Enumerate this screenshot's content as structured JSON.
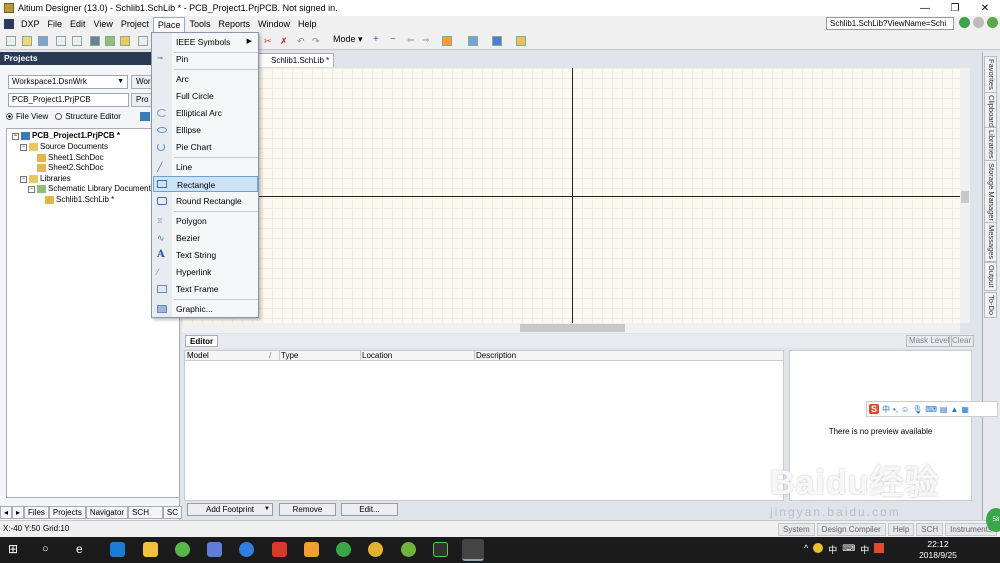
{
  "window": {
    "title": "Altium Designer (13.0) - Schlib1.SchLib * - PCB_Project1.PrjPCB. Not signed in.",
    "controls": [
      "—",
      "❐",
      "✕"
    ]
  },
  "menubar": {
    "items": [
      "DXP",
      "File",
      "Edit",
      "View",
      "Project",
      "Place",
      "Tools",
      "Reports",
      "Window",
      "Help"
    ],
    "active": "Place",
    "path": "Schlib1.SchLib?ViewName=Schi"
  },
  "toolbar": {
    "mode_label": "Mode ▾"
  },
  "projects": {
    "header": "Projects",
    "workspace": "Workspace1.DsnWrk",
    "workspace_btn": "Work",
    "project": "PCB_Project1.PrjPCB",
    "project_btn": "Pro",
    "file_view": "File View",
    "structure_editor": "Structure Editor",
    "tree": {
      "root": "PCB_Project1.PrjPCB *",
      "source_documents": "Source Documents",
      "sheet1": "Sheet1.SchDoc",
      "sheet2": "Sheet2.SchDoc",
      "libraries": "Libraries",
      "schematic_libraries": "Schematic Library Documents",
      "schlib": "Schlib1.SchLib *"
    },
    "bottom_tabs": [
      "Files",
      "Projects",
      "Navigator",
      "SCH Library",
      "SC"
    ]
  },
  "document": {
    "tab": "Schlib1.SchLib *"
  },
  "right_tabs": [
    "Favorites",
    "Clipboard",
    "Libraries",
    "Storage Manager",
    "Messages",
    "Output",
    "To-Do"
  ],
  "place_menu": {
    "items": [
      {
        "label": "IEEE Symbols",
        "icon": "none",
        "submenu": true
      },
      {
        "label": "Pin",
        "icon": "pin-icon"
      },
      {
        "label": "Arc",
        "icon": "arc-icon"
      },
      {
        "label": "Full Circle",
        "icon": "none"
      },
      {
        "label": "Elliptical Arc",
        "icon": "elliptical-arc-icon"
      },
      {
        "label": "Ellipse",
        "icon": "ellipse-icon"
      },
      {
        "label": "Pie Chart",
        "icon": "pie-chart-icon"
      },
      {
        "label": "Line",
        "icon": "line-icon"
      },
      {
        "label": "Rectangle",
        "icon": "rectangle-icon"
      },
      {
        "label": "Round Rectangle",
        "icon": "round-rectangle-icon"
      },
      {
        "label": "Polygon",
        "icon": "polygon-icon"
      },
      {
        "label": "Bezier",
        "icon": "bezier-icon"
      },
      {
        "label": "Text String",
        "icon": "text-string-icon"
      },
      {
        "label": "Hyperlink",
        "icon": "hyperlink-icon"
      },
      {
        "label": "Text Frame",
        "icon": "text-frame-icon"
      },
      {
        "label": "Graphic...",
        "icon": "graphic-icon"
      }
    ],
    "highlighted": "Rectangle"
  },
  "editor": {
    "tab": "Editor",
    "mask_level": "Mask Level",
    "clear": "Clear",
    "columns": [
      "Model",
      "Type",
      "Location",
      "Description"
    ],
    "preview_text": "There is no preview available",
    "buttons": {
      "add_footprint": "Add Footprint",
      "remove": "Remove",
      "edit": "Edit..."
    }
  },
  "statusbar": {
    "coords": "X:-40 Y:50",
    "grid": "Grid:10",
    "right": [
      "System",
      "Design Compiler",
      "Help",
      "SCH",
      "Instruments"
    ]
  },
  "taskbar": {
    "time": "22:12",
    "date": "2018/9/25",
    "tray": [
      "^",
      "中",
      "⌨",
      "中"
    ]
  },
  "ime": {
    "label": "中"
  },
  "watermark": {
    "main": "Baidu经验",
    "sub": "jingyan.baidu.com"
  },
  "green_badge": "58"
}
